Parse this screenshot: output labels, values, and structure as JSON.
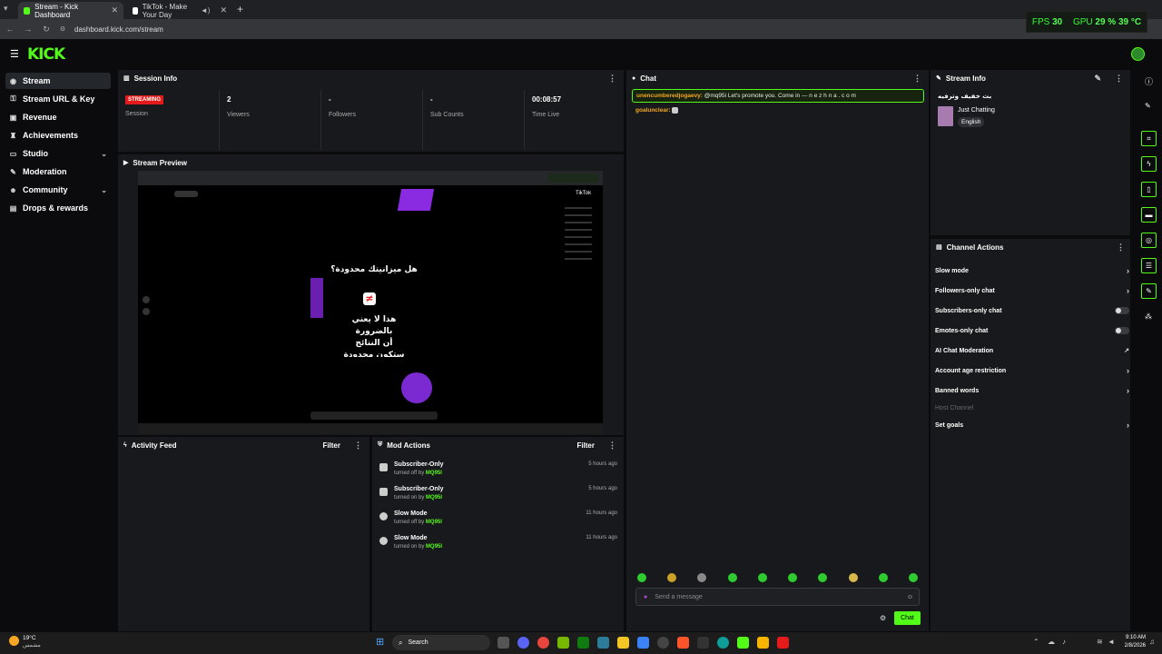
{
  "browser": {
    "tabs": [
      {
        "title": "Stream - Kick Dashboard",
        "active": true
      },
      {
        "title": "TikTok - Make Your Day",
        "active": false
      }
    ],
    "url": "dashboard.kick.com/stream",
    "perf": {
      "fps_label": "FPS",
      "fps_value": "30",
      "gpu_label": "GPU",
      "gpu_value": "29 %",
      "temp": "39 °C"
    }
  },
  "brand": {
    "logo": "KICK",
    "accent": "#53fc18"
  },
  "sidebar": {
    "items": [
      {
        "label": "Stream",
        "icon": "stream-icon",
        "active": true
      },
      {
        "label": "Stream URL & Key",
        "icon": "key-icon"
      },
      {
        "label": "Revenue",
        "icon": "revenue-icon"
      },
      {
        "label": "Achievements",
        "icon": "trophy-icon"
      },
      {
        "label": "Studio",
        "icon": "studio-icon",
        "expandable": true
      },
      {
        "label": "Moderation",
        "icon": "wrench-icon"
      },
      {
        "label": "Community",
        "icon": "community-icon",
        "expandable": true
      },
      {
        "label": "Drops & rewards",
        "icon": "gift-icon"
      }
    ]
  },
  "session_info": {
    "title": "Session Info",
    "status_badge": "STREAMING",
    "stats": [
      {
        "value": "",
        "label": "Session"
      },
      {
        "value": "2",
        "label": "Viewers"
      },
      {
        "value": "-",
        "label": "Followers"
      },
      {
        "value": "-",
        "label": "Sub Counts"
      },
      {
        "value": "00:08:57",
        "label": "Time Live"
      }
    ]
  },
  "stream_preview": {
    "title": "Stream Preview",
    "caption_line1": "هل ميزانيتك محدودة؟",
    "caption_line2": "هذا لا يعني",
    "caption_line3": "بالضرورة",
    "caption_line4": "أن النتائج",
    "caption_line5": "ستكون محدودة",
    "tiktok_logo": "TikTok"
  },
  "activity_feed": {
    "title": "Activity Feed",
    "filter": "Filter"
  },
  "mod_actions": {
    "title": "Mod Actions",
    "filter": "Filter",
    "items": [
      {
        "title": "Subscriber-Only",
        "action": "turned off by",
        "user": "MQ95I",
        "ago": "5 hours ago"
      },
      {
        "title": "Subscriber-Only",
        "action": "turned on by",
        "user": "MQ95I",
        "ago": "5 hours ago"
      },
      {
        "title": "Slow Mode",
        "action": "turned off by",
        "user": "MQ95I",
        "ago": "11 hours ago"
      },
      {
        "title": "Slow Mode",
        "action": "turned on by",
        "user": "MQ95I",
        "ago": "11 hours ago"
      }
    ]
  },
  "chat": {
    "title": "Chat",
    "messages": [
      {
        "user": "unencumberedjogaevy:",
        "text": "@mq95i Let's promote you. Come in — n e z h n a . c o m"
      },
      {
        "user": "goalunclear:",
        "text": ""
      }
    ],
    "placeholder": "Send a message",
    "send_label": "Chat"
  },
  "stream_info": {
    "title": "Stream Info",
    "stream_title": "بث خفيف وترفيه",
    "category": "Just Chatting",
    "language": "English"
  },
  "channel_actions": {
    "title": "Channel Actions",
    "items": [
      {
        "label": "Slow mode",
        "type": "arrow"
      },
      {
        "label": "Followers-only chat",
        "type": "arrow"
      },
      {
        "label": "Subscribers-only chat",
        "type": "toggle"
      },
      {
        "label": "Emotes-only chat",
        "type": "toggle"
      },
      {
        "label": "AI Chat Moderation",
        "type": "ext"
      },
      {
        "label": "Account age restriction",
        "type": "arrow"
      },
      {
        "label": "Banned words",
        "type": "arrow"
      },
      {
        "label": "Host Channel",
        "type": "disabled"
      },
      {
        "label": "Set goals",
        "type": "arrow"
      }
    ]
  },
  "taskbar": {
    "weather_temp": "19°C",
    "weather_desc": "مشمس",
    "search": "Search",
    "time": "9:10 AM",
    "date": "2/8/2026"
  }
}
